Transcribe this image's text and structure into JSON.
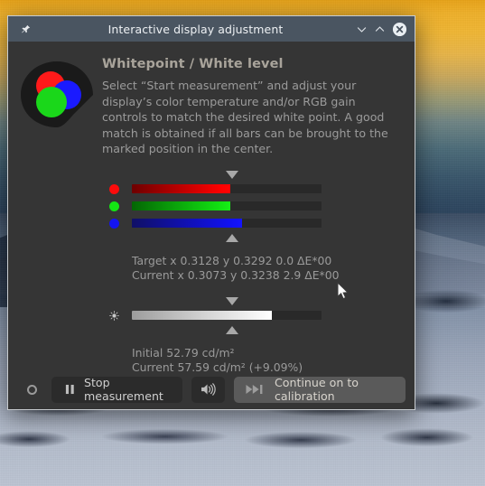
{
  "window": {
    "title": "Interactive display adjustment",
    "pin_icon": "pin-icon",
    "minimize_icon": "chevron-down-icon",
    "maximize_icon": "chevron-up-icon",
    "close_icon": "close-circle-icon"
  },
  "header": {
    "logo_icon": "rgb-circles-logo-icon",
    "title": "Whitepoint / White level",
    "body": "Select “Start measurement” and adjust your display’s color temperature and/or RGB gain controls to match the desired white point. A good match is obtained if all bars can be brought to the marked position in the center."
  },
  "rgb_sliders": {
    "marker_top_icon": "triangle-down-marker-icon",
    "marker_bottom_icon": "triangle-up-marker-icon",
    "marker_position_pct": 61,
    "channels": [
      {
        "name": "red",
        "dot_icon": "red-channel-dot-icon",
        "fill_pct": 52,
        "color": "#ff0000"
      },
      {
        "name": "green",
        "dot_icon": "green-channel-dot-icon",
        "fill_pct": 52,
        "color": "#12e512"
      },
      {
        "name": "blue",
        "dot_icon": "blue-channel-dot-icon",
        "fill_pct": 58,
        "color": "#1414f0"
      }
    ],
    "readout": {
      "target": "Target x 0.3128 y 0.3292 0.0 ΔE*00",
      "current": "Current x 0.3073 y 0.3238 2.9 ΔE*00"
    }
  },
  "brightness": {
    "icon": "brightness-sun-icon",
    "marker_top_icon": "triangle-down-marker-icon",
    "marker_bottom_icon": "triangle-up-marker-icon",
    "marker_position_pct": 61,
    "fill_pct": 74,
    "readout": {
      "initial": "Initial 52.79 cd/m²",
      "current": "Current 57.59 cd/m² (+9.09%)"
    }
  },
  "footer": {
    "status_icon": "measurement-ring-icon",
    "stop_button": {
      "label": "Stop measurement",
      "icon": "pause-icon"
    },
    "sound_button": {
      "icon": "speaker-volume-icon"
    },
    "continue_button": {
      "label": "Continue on to calibration",
      "icon": "skip-forward-icon"
    }
  },
  "desktop": {
    "wallpaper_description": "snowy-mountain-sunset-wallpaper",
    "cursor_icon": "mouse-pointer-icon"
  },
  "colors": {
    "titlebar": "#4a5561",
    "accent": "#29a8e0",
    "dialog_bg": "#353535",
    "button_dark": "#2b2b2b",
    "button_light": "#5a5a5a"
  }
}
